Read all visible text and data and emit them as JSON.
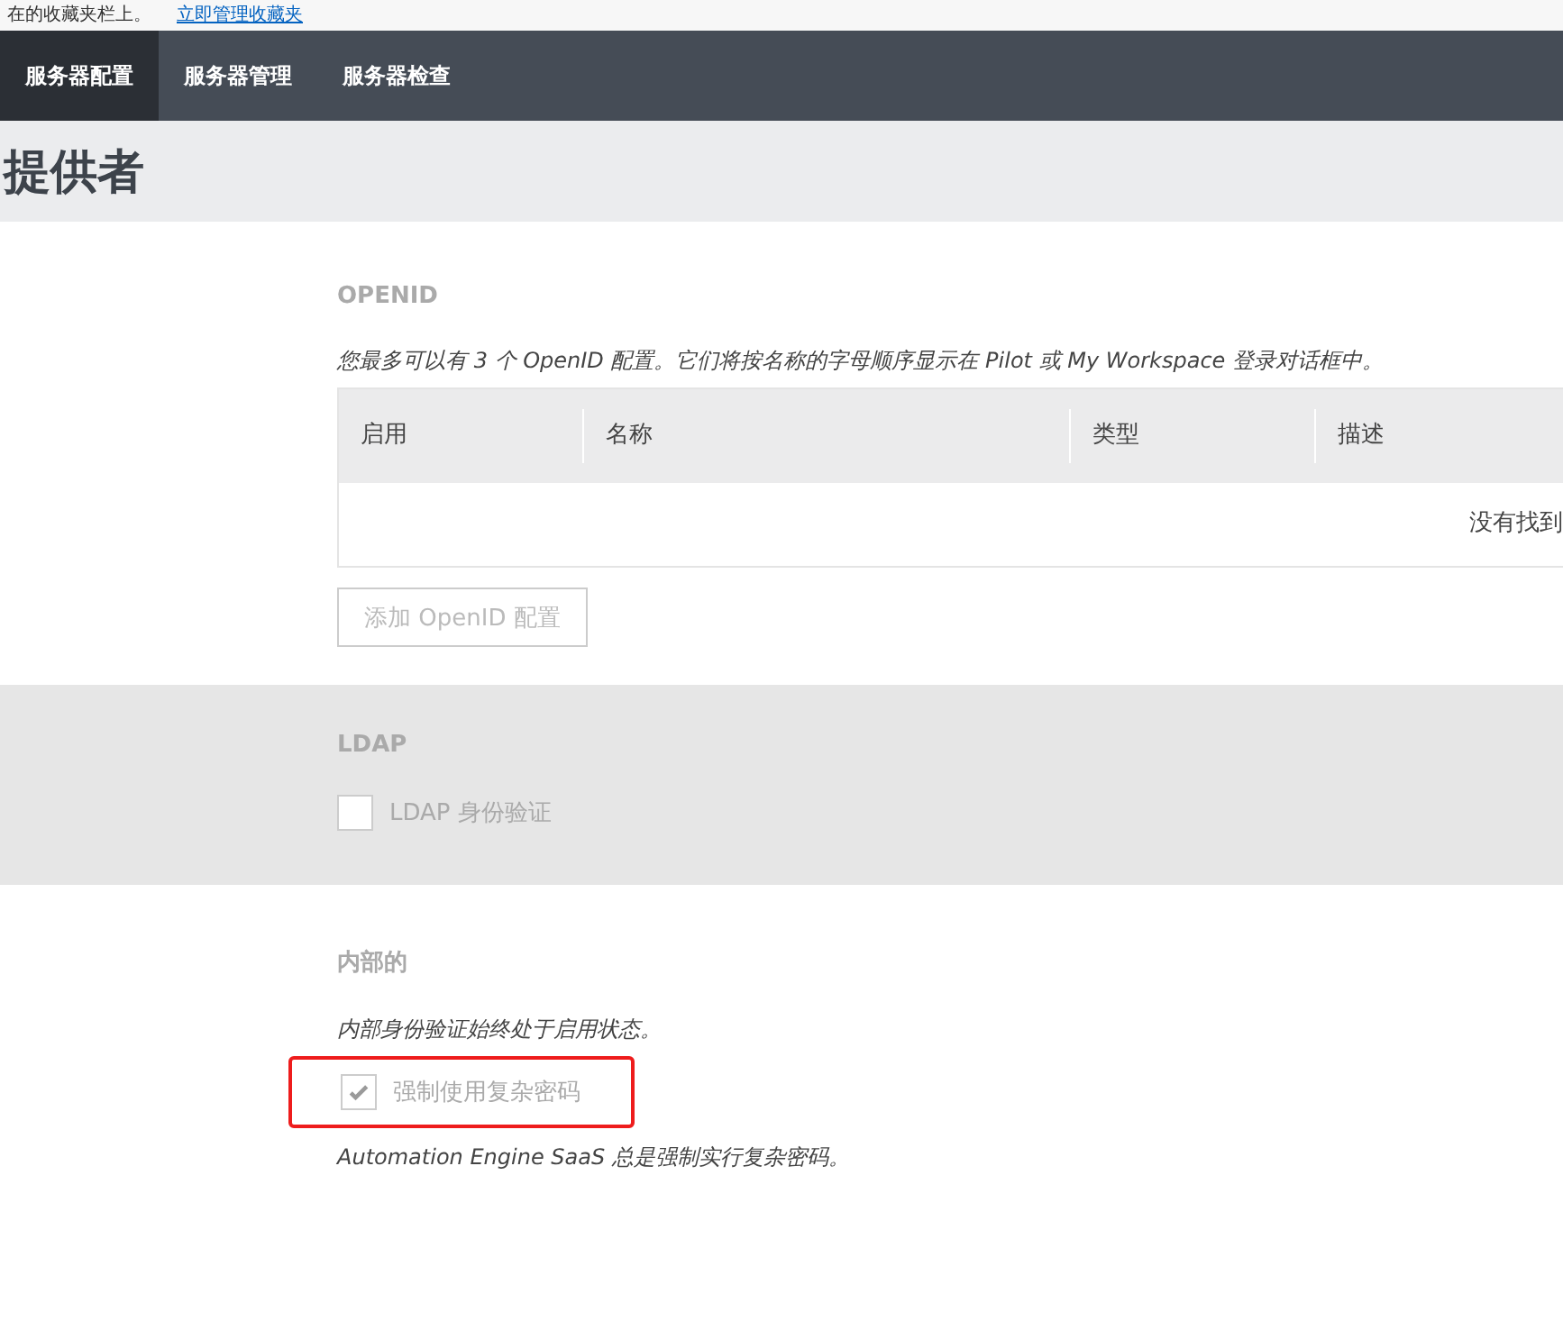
{
  "notice": {
    "text": "在的收藏夹栏上。",
    "link": "立即管理收藏夹"
  },
  "nav": {
    "tabs": [
      {
        "label": "服务器配置",
        "selected": true
      },
      {
        "label": "服务器管理",
        "selected": false
      },
      {
        "label": "服务器检查",
        "selected": false
      }
    ]
  },
  "page_title": "提供者",
  "openid": {
    "title": "OPENID",
    "description": "您最多可以有 3 个 OpenID 配置。它们将按名称的字母顺序显示在 Pilot 或 My Workspace 登录对话框中。",
    "table": {
      "columns": [
        "启用",
        "名称",
        "类型",
        "描述"
      ],
      "empty_text": "没有找到"
    },
    "add_button": {
      "label": "添加 OpenID 配置",
      "disabled": true
    }
  },
  "ldap": {
    "title": "LDAP",
    "checkbox": {
      "label": "LDAP 身份验证",
      "checked": false,
      "disabled": true
    }
  },
  "internal": {
    "title": "内部的",
    "description": "内部身份验证始终处于启用状态。",
    "checkbox": {
      "label": "强制使用复杂密码",
      "checked": true,
      "disabled": true,
      "highlighted": true
    },
    "note": "Automation Engine SaaS 总是强制实行复杂密码。"
  }
}
